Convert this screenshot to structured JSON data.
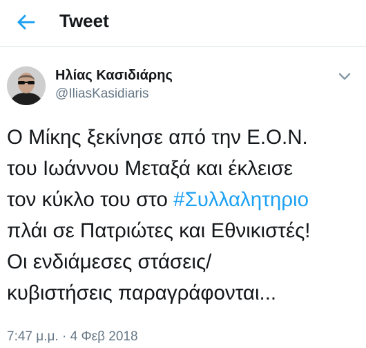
{
  "header": {
    "back_icon": "back-arrow-icon",
    "title": "Tweet"
  },
  "author": {
    "name": "Ηλίας Κασιδιάρης",
    "handle": "@IliasKasidiaris",
    "menu_icon": "chevron-down-icon"
  },
  "tweet": {
    "lines": [
      "Ο Μίκης ξεκίνησε από την Ε.Ο.Ν.",
      "του Ιωάννου Μεταξά και έκλεισε",
      "τον κύκλο του στο ",
      "πλάι σε Πατριώτες και Εθνικιστές!",
      "Οι ενδιάμεσες στάσεις/",
      "κυβιστήσεις παραγράφονται..."
    ],
    "hashtag": "#Συλλαλητηριο"
  },
  "meta": {
    "timestamp": "7:47 μ.μ. · 4 Φεβ 2018"
  },
  "colors": {
    "accent": "#1da1f2",
    "text": "#14171a",
    "secondary": "#657786",
    "divider": "#e1e8ed"
  }
}
